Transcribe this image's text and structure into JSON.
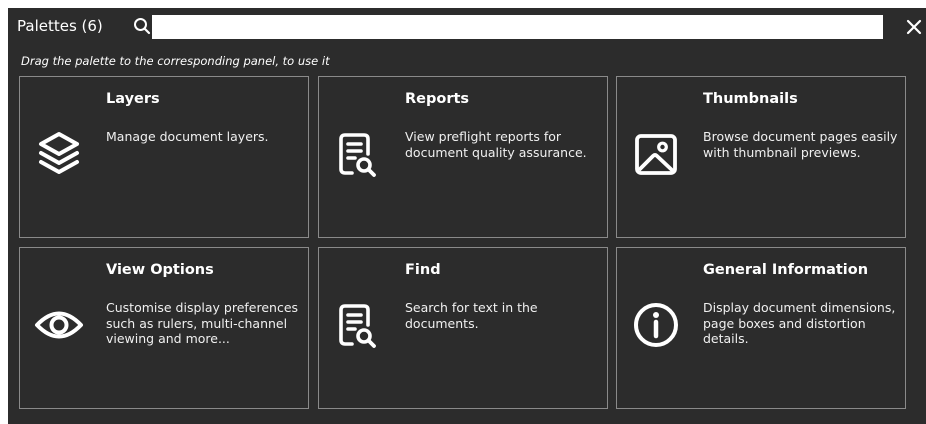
{
  "header": {
    "title": "Palettes (6)",
    "search_value": "",
    "search_icon": "search-icon",
    "close_icon": "close-icon"
  },
  "hint": "Drag the palette to the corresponding panel, to use it",
  "colors": {
    "background": "#2c2c2c",
    "card_border": "#8a8a8a",
    "text": "#ffffff"
  },
  "palettes": [
    {
      "title": "Layers",
      "description": "Manage document layers.",
      "icon": "layers-icon"
    },
    {
      "title": "Reports",
      "description": "View preflight reports for document quality assurance.",
      "icon": "report-icon"
    },
    {
      "title": "Thumbnails",
      "description": "Browse document pages easily with thumbnail previews.",
      "icon": "image-icon"
    },
    {
      "title": "View Options",
      "description": "Customise display preferences such as rulers, multi-channel viewing and more...",
      "icon": "eye-icon"
    },
    {
      "title": "Find",
      "description": "Search for text in the documents.",
      "icon": "document-search-icon"
    },
    {
      "title": "General Information",
      "description": "Display document dimensions, page boxes and distortion details.",
      "icon": "info-icon"
    }
  ]
}
